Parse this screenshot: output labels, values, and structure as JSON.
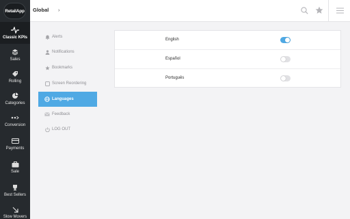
{
  "app": {
    "logo_text": "RetailApp"
  },
  "topbar": {
    "breadcrumb": "Global",
    "breadcrumb_chevron": "›",
    "icons": [
      "search-icon",
      "star-icon",
      "hamburger-menu-icon"
    ]
  },
  "rail": {
    "items": [
      {
        "label": "Classic KPIs",
        "icon": "pulse-icon",
        "active": true
      },
      {
        "label": "Sales",
        "icon": "layers-icon"
      },
      {
        "label": "Rolling",
        "icon": "tag-icon"
      },
      {
        "label": "Categories",
        "icon": "pie-chart-icon"
      },
      {
        "label": "Conversion",
        "icon": "conversion-icon"
      },
      {
        "label": "Payments",
        "icon": "credit-card-icon"
      },
      {
        "label": "Sale",
        "icon": "briefcase-icon"
      },
      {
        "label": "Best Sellers",
        "icon": "trophy-icon"
      },
      {
        "label": "Slow Movers",
        "icon": "arrow-down-right-icon"
      }
    ]
  },
  "settings_menu": {
    "items": [
      {
        "label": "Alerts",
        "icon": "bell-icon"
      },
      {
        "label": "Notifications",
        "icon": "person-icon"
      },
      {
        "label": "Bookmarks",
        "icon": "star-icon"
      },
      {
        "label": "Screen Reordering",
        "icon": "square-icon"
      },
      {
        "label": "Languages",
        "icon": "globe-icon",
        "active": true
      },
      {
        "label": "Feedback",
        "icon": "envelope-icon"
      },
      {
        "label": "LOG OUT",
        "icon": "power-icon"
      }
    ]
  },
  "languages": [
    {
      "name": "English",
      "enabled": true
    },
    {
      "name": "Español",
      "enabled": false
    },
    {
      "name": "Português",
      "enabled": false
    }
  ],
  "colors": {
    "accent": "#4fa9e4",
    "rail_bg": "#262a2e",
    "page_bg": "#f3f3f5"
  }
}
